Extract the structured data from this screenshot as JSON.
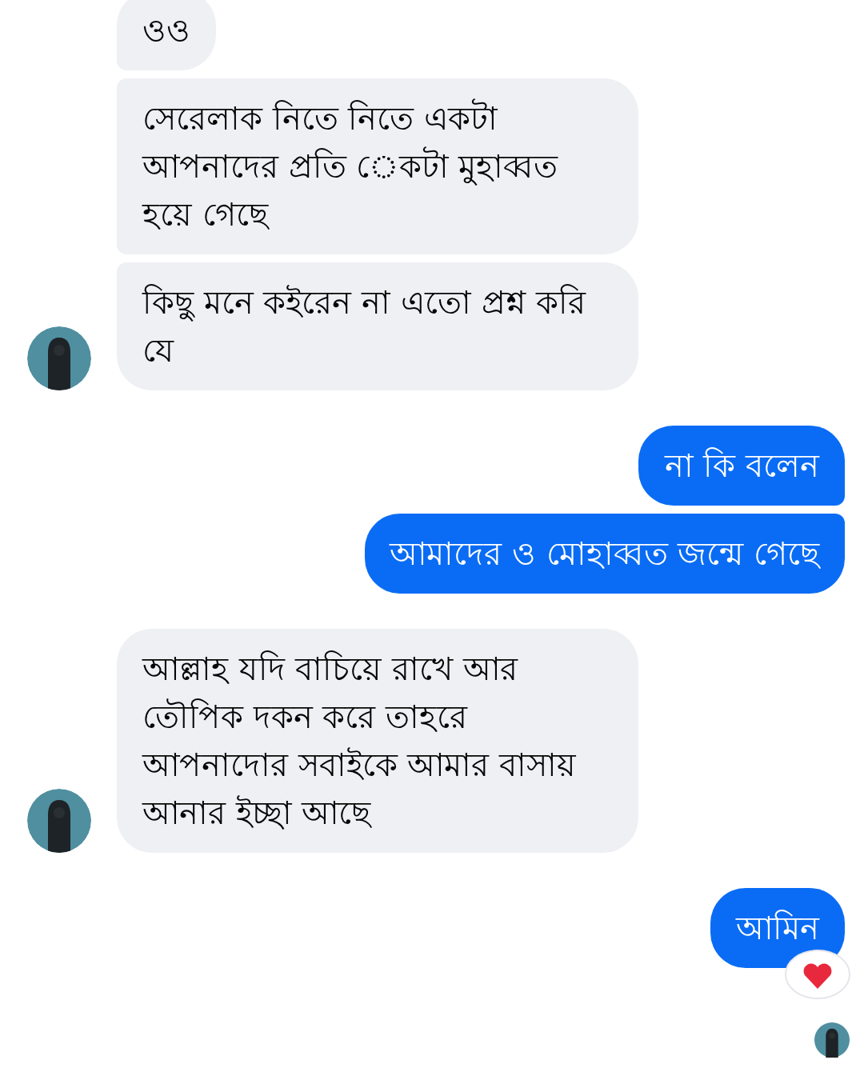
{
  "conversation": [
    {
      "outgoing": false,
      "messages": [
        {
          "text": "ওও",
          "reacted": false
        },
        {
          "text": "সেরেলাক নিতে নিতে একটা আপনাদের প্রতি েকটা মুহাব্বত হয়ে গেছে",
          "reacted": false
        },
        {
          "text": "কিছু মনে কইরেন না এতো প্রশ্ন করি যে",
          "reacted": false
        }
      ]
    },
    {
      "outgoing": true,
      "messages": [
        {
          "text": "না কি বলেন",
          "reacted": false
        },
        {
          "text": "আমাদের ও মোহাব্বত জন্মে গেছে",
          "reacted": false
        }
      ]
    },
    {
      "outgoing": false,
      "messages": [
        {
          "text": "আল্লাহ যদি বাচিয়ে রাখে আর তৌপিক দকন করে তাহরে আপনাদোর সবাইকে আমার বাসায় আনার ইচ্ছা আছে",
          "reacted": false
        }
      ]
    },
    {
      "outgoing": true,
      "messages": [
        {
          "text": "আমিন",
          "reacted": true
        }
      ]
    }
  ],
  "seen": true
}
